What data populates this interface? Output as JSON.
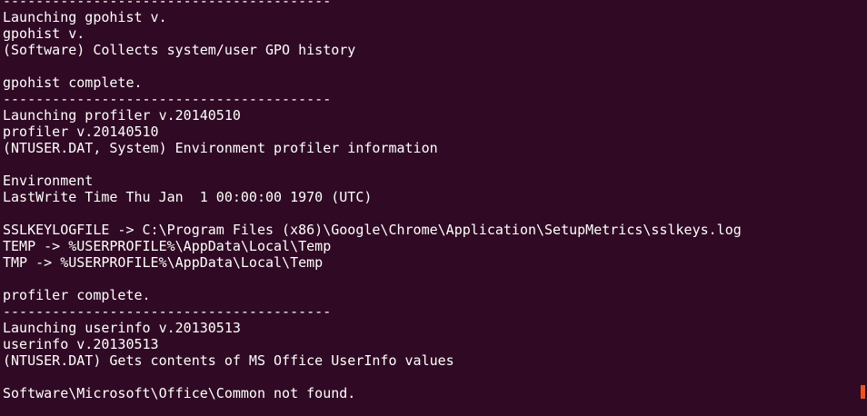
{
  "terminal": {
    "lines": [
      "----------------------------------------",
      "Launching gpohist v.",
      "gpohist v.",
      "(Software) Collects system/user GPO history",
      "",
      "gpohist complete.",
      "----------------------------------------",
      "Launching profiler v.20140510",
      "profiler v.20140510",
      "(NTUSER.DAT, System) Environment profiler information",
      "",
      "Environment",
      "LastWrite Time Thu Jan  1 00:00:00 1970 (UTC)",
      "",
      "SSLKEYLOGFILE -> C:\\Program Files (x86)\\Google\\Chrome\\Application\\SetupMetrics\\sslkeys.log",
      "TEMP -> %USERPROFILE%\\AppData\\Local\\Temp",
      "TMP -> %USERPROFILE%\\AppData\\Local\\Temp",
      "",
      "profiler complete.",
      "----------------------------------------",
      "Launching userinfo v.20130513",
      "userinfo v.20130513",
      "(NTUSER.DAT) Gets contents of MS Office UserInfo values",
      "",
      "Software\\Microsoft\\Office\\Common not found."
    ],
    "colors": {
      "background": "#300a24",
      "text": "#ffffff",
      "accent": "#e95420"
    }
  }
}
